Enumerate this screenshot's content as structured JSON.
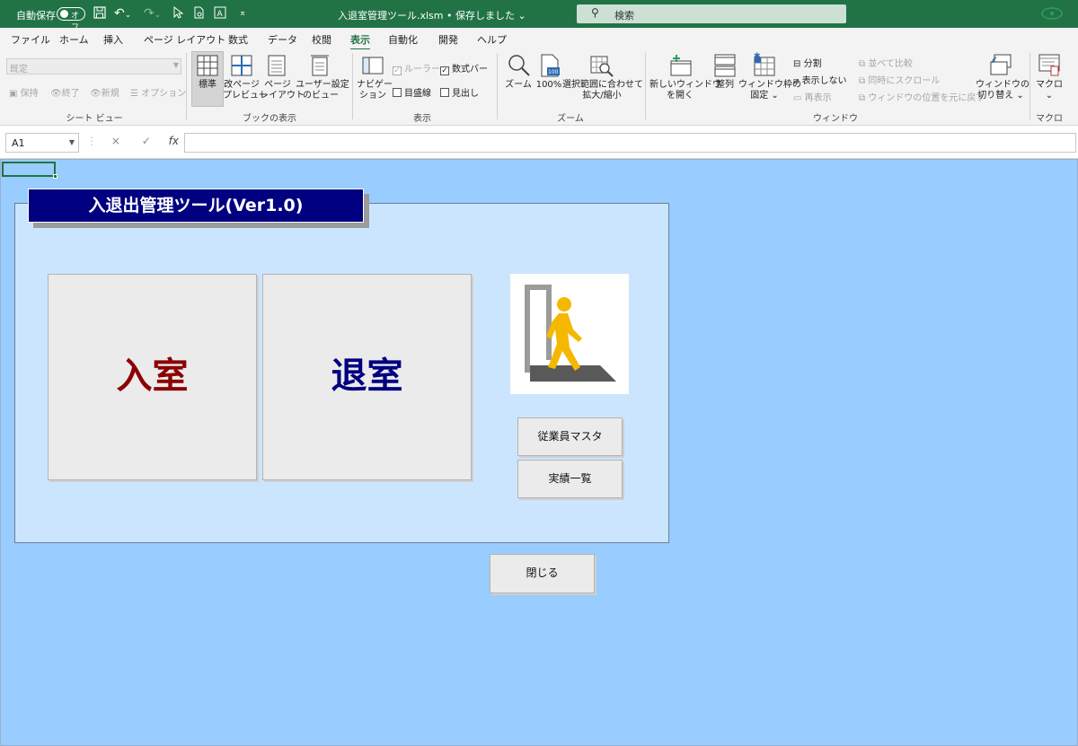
{
  "titlebar": {
    "autosave_label": "自動保存",
    "autosave_state": "オフ",
    "document_title": "入退室管理ツール.xlsm • 保存しました ⌄",
    "search_placeholder": "検索",
    "colors": {
      "titlebar_bg": "#217346"
    }
  },
  "menu": {
    "tabs": [
      "ファイル",
      "ホーム",
      "挿入",
      "ページ レイアウト",
      "数式",
      "データ",
      "校閲",
      "表示",
      "自動化",
      "開発",
      "ヘルプ"
    ],
    "active_tab": "表示"
  },
  "ribbon": {
    "sheet_view": {
      "select_value": "既定",
      "keep": "保持",
      "exit": "終了",
      "new": "新規",
      "options": "オプション",
      "group_label": "シート ビュー"
    },
    "workbook_views": {
      "normal": "標準",
      "page_break_1": "改ページ",
      "page_break_2": "プレビュー",
      "page_layout_1": "ページ",
      "page_layout_2": "レイアウト",
      "custom_1": "ユーザー設定",
      "custom_2": "のビュー",
      "group_label": "ブックの表示"
    },
    "show": {
      "navigation_1": "ナビゲー",
      "navigation_2": "ション",
      "ruler": "ルーラー",
      "formula_bar": "数式バー",
      "gridlines": "目盛線",
      "headings": "見出し",
      "group_label": "表示"
    },
    "zoom": {
      "zoom": "ズーム",
      "hundred": "100%",
      "fit_1": "選択範囲に合わせて",
      "fit_2": "拡大/縮小",
      "group_label": "ズーム"
    },
    "window": {
      "new_window_1": "新しいウィンドウ",
      "new_window_2": "を開く",
      "arrange": "整列",
      "freeze_1": "ウィンドウ枠の",
      "freeze_2": "固定 ⌄",
      "split": "分割",
      "hide": "表示しない",
      "unhide": "再表示",
      "side_by_side": "並べて比較",
      "sync_scroll": "同時にスクロール",
      "reset_position": "ウィンドウの位置を元に戻す",
      "switch_1": "ウィンドウの",
      "switch_2": "切り替え ⌄",
      "group_label": "ウィンドウ"
    },
    "macro": {
      "macro": "マクロ",
      "caret": "⌄",
      "group_label": "マクロ"
    }
  },
  "formula_bar": {
    "name_box": "A1",
    "cancel_icon": "×",
    "enter_icon": "✓",
    "fx_icon": "fx",
    "value": ""
  },
  "sheet": {
    "title": "入退出管理ツール(Ver1.0)",
    "enter_button": "入室",
    "exit_button": "退室",
    "employee_master_button": "従業員マスタ",
    "records_button": "実績一覧",
    "close_button": "閉じる",
    "colors": {
      "sheet_bg": "#99ccff",
      "panel_bg": "#cce5ff",
      "title_bg": "#000080",
      "enter_text": "#8b0000",
      "exit_text": "#000080",
      "figure": "#f5b800"
    },
    "picture_icon": "walking-person-door-icon"
  }
}
